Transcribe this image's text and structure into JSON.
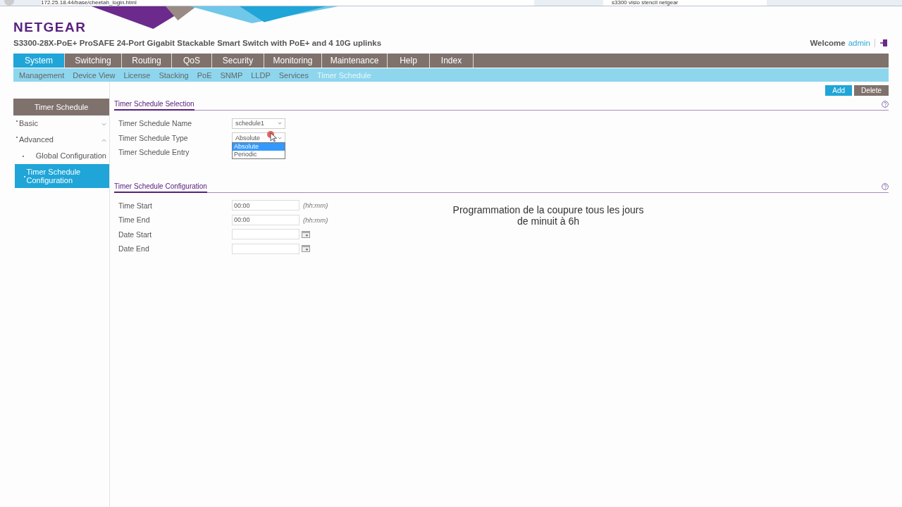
{
  "browser": {
    "url": "172.25.18.44/base/cheetah_login.html",
    "search": "s3300 visio stencil netgear"
  },
  "header": {
    "logo": "NETGEAR",
    "product": "S3300-28X-PoE+ ProSAFE 24-Port Gigabit Stackable Smart Switch with PoE+ and 4 10G uplinks",
    "welcome": "Welcome",
    "user": "admin"
  },
  "tabs": [
    {
      "label": "System",
      "selected": true
    },
    {
      "label": "Switching",
      "selected": false
    },
    {
      "label": "Routing",
      "selected": false
    },
    {
      "label": "QoS",
      "selected": false
    },
    {
      "label": "Security",
      "selected": false
    },
    {
      "label": "Monitoring",
      "selected": false
    },
    {
      "label": "Maintenance",
      "selected": false
    },
    {
      "label": "Help",
      "selected": false
    },
    {
      "label": "Index",
      "selected": false
    }
  ],
  "subtabs": [
    {
      "label": "Management",
      "selected": false
    },
    {
      "label": "Device View",
      "selected": false
    },
    {
      "label": "License",
      "selected": false
    },
    {
      "label": "Stacking",
      "selected": false
    },
    {
      "label": "PoE",
      "selected": false
    },
    {
      "label": "SNMP",
      "selected": false
    },
    {
      "label": "LLDP",
      "selected": false
    },
    {
      "label": "Services",
      "selected": false
    },
    {
      "label": "Timer Schedule",
      "selected": true
    }
  ],
  "buttons": [
    {
      "label": "Add",
      "kind": "primary"
    },
    {
      "label": "Delete",
      "kind": "secondary"
    }
  ],
  "sidebar": {
    "title": "Timer Schedule",
    "items": [
      {
        "label": "Basic",
        "expanded": false,
        "selected": false
      },
      {
        "label": "Advanced",
        "expanded": true,
        "selected": false,
        "children": [
          {
            "label": "Global Configuration",
            "selected": false
          },
          {
            "label": "Timer Schedule Configuration",
            "selected": true
          }
        ]
      }
    ]
  },
  "selection": {
    "title": "Timer Schedule Selection",
    "name_label": "Timer Schedule Name",
    "name_value": "schedule1",
    "type_label": "Timer Schedule Type",
    "type_value": "Absolute",
    "type_options": [
      {
        "label": "Absolute",
        "selected": true
      },
      {
        "label": "Periodic",
        "selected": false
      }
    ],
    "entry_label": "Timer Schedule Entry"
  },
  "configuration": {
    "title": "Timer Schedule Configuration",
    "fields": [
      {
        "label": "Time Start",
        "value": "00:00",
        "hint": "(hh:mm)",
        "kind": "time"
      },
      {
        "label": "Time End",
        "value": "00:00",
        "hint": "(hh:mm)",
        "kind": "time"
      },
      {
        "label": "Date Start",
        "kind": "date"
      },
      {
        "label": "Date End",
        "kind": "date"
      }
    ]
  },
  "caption": [
    "Programmation de la coupure tous les jours",
    "de minuit à 6h"
  ]
}
